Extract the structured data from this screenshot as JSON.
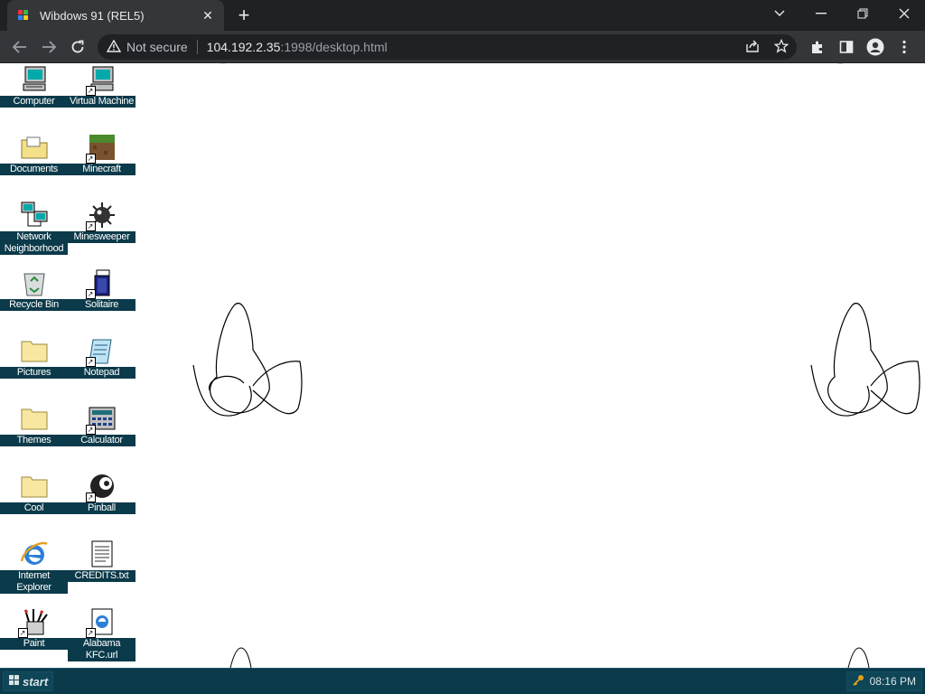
{
  "browser": {
    "tab_title": "Wibdows 91 (REL5)",
    "url_warning": "Not secure",
    "url_host": "104.192.2.35",
    "url_path": ":1998/desktop.html"
  },
  "desktop_icons": [
    {
      "label": "Computer"
    },
    {
      "label": "Virtual Machine"
    },
    {
      "label": "Documents"
    },
    {
      "label": "Minecraft"
    },
    {
      "label": "Network Neighborhood"
    },
    {
      "label": "Minesweeper"
    },
    {
      "label": "Recycle Bin"
    },
    {
      "label": "Solitaire"
    },
    {
      "label": "Pictures"
    },
    {
      "label": "Notepad"
    },
    {
      "label": "Themes"
    },
    {
      "label": "Calculator"
    },
    {
      "label": "Cool"
    },
    {
      "label": "Pinball"
    },
    {
      "label": "Internet Explorer"
    },
    {
      "label": "CREDITS.txt"
    },
    {
      "label": "Paint"
    },
    {
      "label": "Alabama KFC.url"
    }
  ],
  "taskbar": {
    "start_label": "start",
    "clock": "08:16 PM"
  },
  "colors": {
    "taskbar_bg": "#0b3a4a",
    "label_bg": "#0b3a4a",
    "chrome_dark": "#202124"
  }
}
